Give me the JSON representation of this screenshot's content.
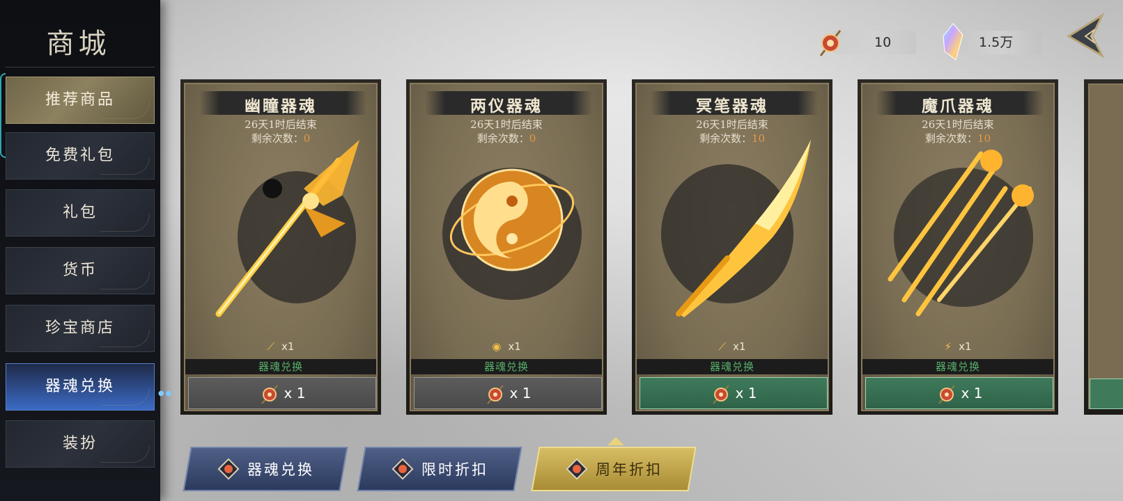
{
  "sidebar": {
    "title": "商城",
    "items": [
      {
        "label": "推荐商品",
        "state": "recommended"
      },
      {
        "label": "免费礼包",
        "state": "normal"
      },
      {
        "label": "礼包",
        "state": "normal"
      },
      {
        "label": "货币",
        "state": "normal"
      },
      {
        "label": "珍宝商店",
        "state": "normal"
      },
      {
        "label": "器魂兑换",
        "state": "selected"
      },
      {
        "label": "装扮",
        "state": "normal"
      }
    ]
  },
  "currency": {
    "token_amount": "10",
    "token_icon": "soul-token-icon",
    "crystal_amount": "1.5万",
    "crystal_icon": "rainbow-crystal-icon"
  },
  "cards": [
    {
      "title": "幽瞳器魂",
      "timer": "26天1时后结束",
      "remain_label": "剩余次数：",
      "remain_value": "0",
      "cost_text": "x1",
      "item_icon": "halberd-icon",
      "type_label": "器魂兑换",
      "buy_text": "x 1",
      "buy_active": false
    },
    {
      "title": "两仪器魂",
      "timer": "26天1时后结束",
      "remain_label": "剩余次数：",
      "remain_value": "0",
      "cost_text": "x1",
      "item_icon": "yin-yang-orb-icon",
      "type_label": "器魂兑换",
      "buy_text": "x 1",
      "buy_active": false
    },
    {
      "title": "冥笔器魂",
      "timer": "26天1时后结束",
      "remain_label": "剩余次数：",
      "remain_value": "10",
      "cost_text": "x1",
      "item_icon": "brush-icon",
      "type_label": "器魂兑换",
      "buy_text": "x 1",
      "buy_active": true
    },
    {
      "title": "魔爪器魂",
      "timer": "26天1时后结束",
      "remain_label": "剩余次数：",
      "remain_value": "10",
      "cost_text": "x1",
      "item_icon": "claw-icon",
      "type_label": "器魂兑换",
      "buy_text": "x 1",
      "buy_active": true
    }
  ],
  "tabs": [
    {
      "label": "器魂兑换",
      "active": false
    },
    {
      "label": "限时折扣",
      "active": false
    },
    {
      "label": "周年折扣",
      "active": true
    }
  ],
  "colors": {
    "accent_gold": "#d6bd63",
    "selected_blue": "#3b6bc4",
    "buy_green": "#3f7a5b",
    "remain_orange": "#e69a45",
    "type_green": "#58b06a"
  }
}
